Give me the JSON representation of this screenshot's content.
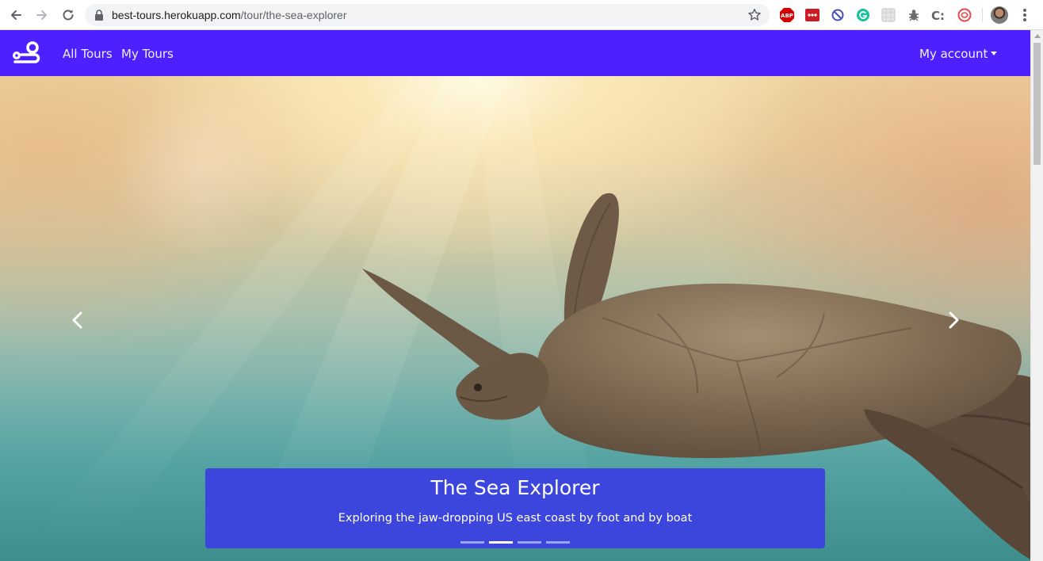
{
  "browser": {
    "url_host": "best-tours.herokuapp.com",
    "url_path": "/tour/the-sea-explorer",
    "extensions": [
      "abp-icon",
      "lastpass-icon",
      "block-icon",
      "grammarly-icon",
      "extension-grid-icon",
      "bug-icon",
      "cookie-icon",
      "hola-icon"
    ],
    "extension_labels": {
      "abp": "ABP",
      "lastpass": "•••",
      "c": "C:"
    }
  },
  "navbar": {
    "background": "#4f20ff",
    "links": [
      {
        "label": "All Tours"
      },
      {
        "label": "My Tours"
      }
    ],
    "account_label": "My account"
  },
  "carousel": {
    "title": "The Sea Explorer",
    "subtitle": "Exploring the jaw-dropping US east coast by foot and by boat",
    "caption_background": "#3d46dc",
    "slide_count": 4,
    "active_slide": 2
  }
}
